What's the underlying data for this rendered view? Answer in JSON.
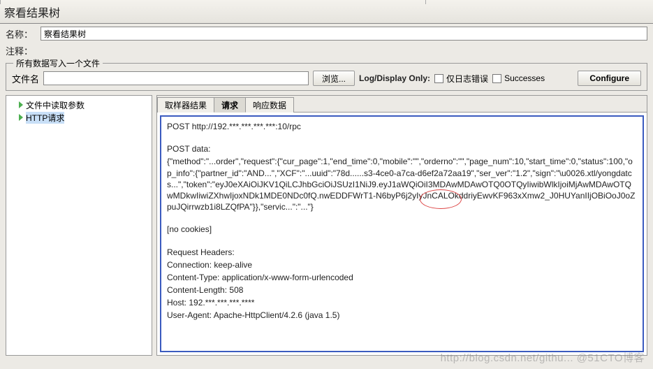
{
  "title": "察看结果树",
  "form": {
    "name_label": "名称：",
    "name_value": "察看结果树",
    "comment_label": "注释：",
    "comment_value": ""
  },
  "file_section": {
    "legend": "所有数据写入一个文件",
    "filename_label": "文件名",
    "browse_label": "浏览...",
    "log_display_label": "Log/Display Only:",
    "errors_only_label": "仅日志错误",
    "successes_label": "Successes",
    "configure_label": "Configure"
  },
  "tree": {
    "items": [
      {
        "label": "文件中读取参数"
      },
      {
        "label": "HTTP请求"
      }
    ],
    "selected_index": 1
  },
  "tabs": {
    "items": [
      {
        "label": "取样器结果"
      },
      {
        "label": "请求"
      },
      {
        "label": "响应数据"
      }
    ],
    "active_index": 1
  },
  "response": {
    "line1": "POST http://192.***.***.***.***:10/rpc",
    "post_data_label": "POST data:",
    "body": "{\"method\":\"...order\",\"request\":{\"cur_page\":1,\"end_time\":0,\"mobile\":\"\",\"orderno\":\"\",\"page_num\":10,\"start_time\":0,\"status\":100,\"op_info\":{\"partner_id\":\"AND...\",\"XCF\":\"...uuid\":\"78d......s3-4ce0-a7ca-d6ef2a72aa19\",\"ser_ver\":\"1.2\",\"sign\":\"\\u0026.xtl/yongdatcs...\",\"token\":\"eyJ0eXAiOiJKV1QiLCJhbGciOiJSUzI1NiJ9.eyJ1aWQiOiI3MDAwMDAwOTQ0OTQyIiwibWlkIjoiMjAwMDAwOTQwMDkwIiwiZXhwIjoxNDk1MDE0NDc0fQ.nwEDDFWrT1-N6byP6j2yIyJnCALOkddriyEwvKF963xXmw2_J0HUYanIIjOBiOoJ0oZpuJQirrwzb1i8LZQfPA\"}},\"servic...\":\"...\"}",
    "no_cookies": "[no cookies]",
    "headers_label": "Request Headers:",
    "headers": [
      "Connection: keep-alive",
      "Content-Type: application/x-www-form-urlencoded",
      "Content-Length: 508",
      "Host: 192.***.***.***.****",
      "User-Agent: Apache-HttpClient/4.2.6 (java 1.5)"
    ]
  },
  "watermark": "http://blog.csdn.net/githu... @51CTO博客"
}
